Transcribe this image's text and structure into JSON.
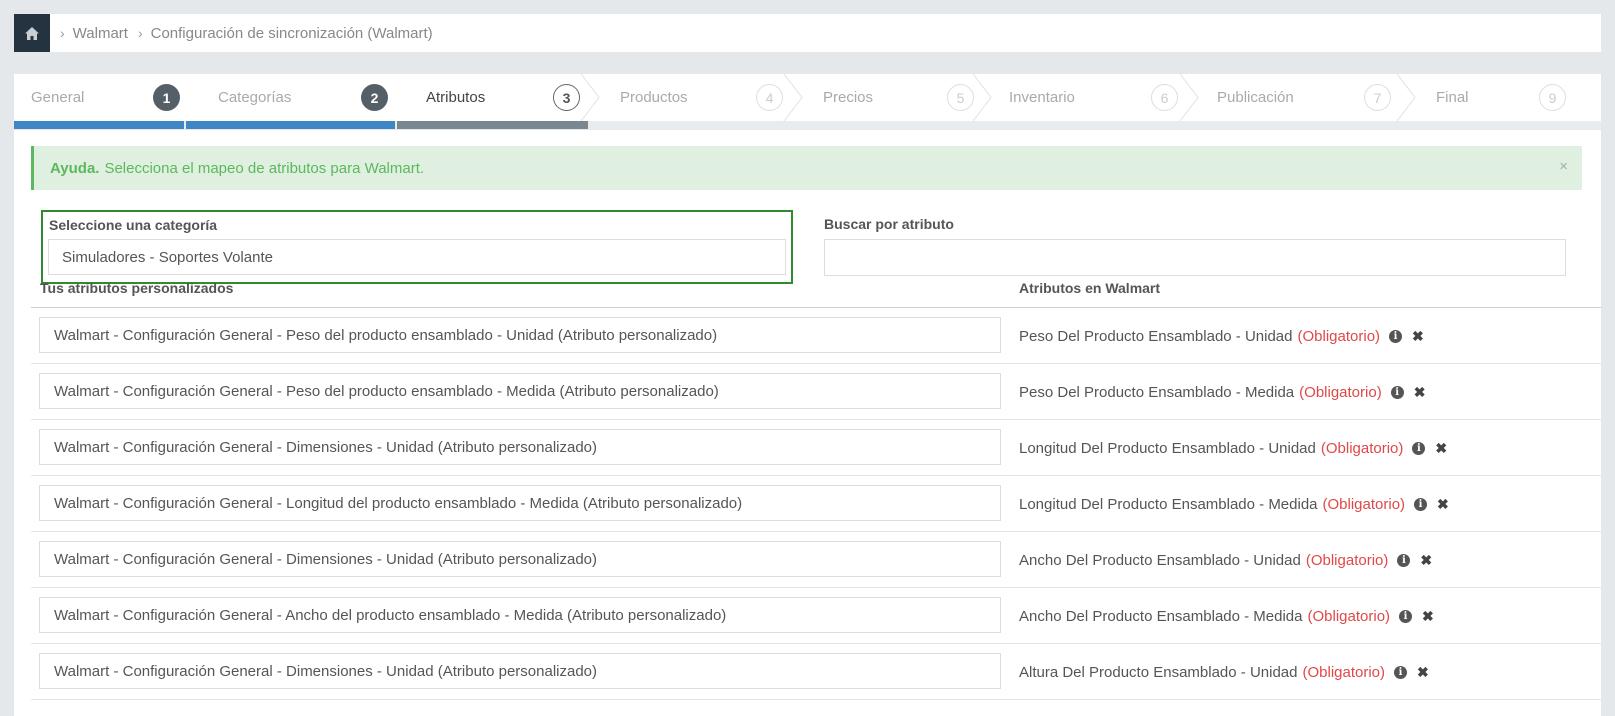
{
  "breadcrumb": {
    "home_icon": "home-icon",
    "items": [
      "Walmart",
      "Configuración de sincronización (Walmart)"
    ]
  },
  "wizard": {
    "steps": [
      {
        "label": "General",
        "number": "1",
        "state": "done"
      },
      {
        "label": "Categorías",
        "number": "2",
        "state": "done"
      },
      {
        "label": "Atributos",
        "number": "3",
        "state": "active"
      },
      {
        "label": "Productos",
        "number": "4",
        "state": "todo"
      },
      {
        "label": "Precios",
        "number": "5",
        "state": "todo"
      },
      {
        "label": "Inventario",
        "number": "6",
        "state": "todo"
      },
      {
        "label": "Publicación",
        "number": "7",
        "state": "todo"
      },
      {
        "label": "Final",
        "number": "9",
        "state": "todo"
      }
    ],
    "colors": {
      "done": "#3f86c6",
      "active": "#7a8791",
      "track": "#e9ecef"
    }
  },
  "alert": {
    "title": "Ayuda.",
    "message": "Selecciona el mapeo de atributos para Walmart.",
    "close": "×"
  },
  "category": {
    "label": "Seleccione una categoría",
    "value": "Simuladores - Soportes Volante"
  },
  "search": {
    "label": "Buscar por atributo",
    "value": ""
  },
  "columns": {
    "custom": "Tus atributos personalizados",
    "walmart": "Atributos en Walmart"
  },
  "required_label": "(Obligatorio)",
  "rows": [
    {
      "custom": "Walmart - Configuración General - Peso del producto ensamblado - Unidad (Atributo personalizado)",
      "walmart": "Peso Del Producto Ensamblado - Unidad"
    },
    {
      "custom": "Walmart - Configuración General - Peso del producto ensamblado - Medida (Atributo personalizado)",
      "walmart": "Peso Del Producto Ensamblado - Medida"
    },
    {
      "custom": "Walmart - Configuración General - Dimensiones - Unidad (Atributo personalizado)",
      "walmart": "Longitud Del Producto Ensamblado - Unidad"
    },
    {
      "custom": "Walmart - Configuración General - Longitud del producto ensamblado - Medida (Atributo personalizado)",
      "walmart": "Longitud Del Producto Ensamblado - Medida"
    },
    {
      "custom": "Walmart - Configuración General - Dimensiones - Unidad (Atributo personalizado)",
      "walmart": "Ancho Del Producto Ensamblado - Unidad"
    },
    {
      "custom": "Walmart - Configuración General - Ancho del producto ensamblado - Medida (Atributo personalizado)",
      "walmart": "Ancho Del Producto Ensamblado - Medida"
    },
    {
      "custom": "Walmart - Configuración General - Dimensiones - Unidad (Atributo personalizado)",
      "walmart": "Altura Del Producto Ensamblado - Unidad"
    }
  ]
}
